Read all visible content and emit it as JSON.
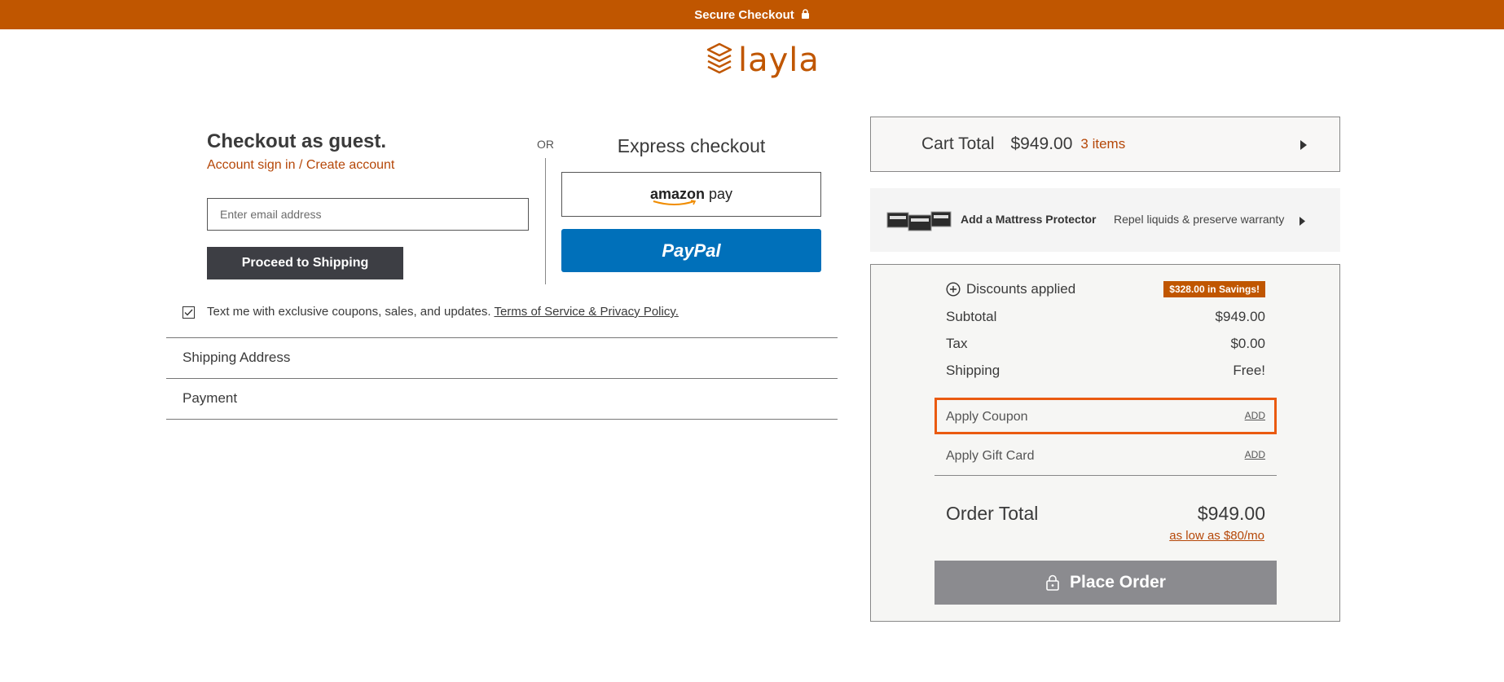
{
  "header": {
    "banner_text": "Secure Checkout",
    "logo_text": "layla",
    "brand_color": "#c05600"
  },
  "guest": {
    "title": "Checkout as guest.",
    "account_link": "Account sign in / Create account",
    "email_placeholder": "Enter email address",
    "proceed_label": "Proceed to Shipping"
  },
  "or_label": "OR",
  "express": {
    "title": "Express checkout",
    "amazon_label_bold": "amazon",
    "amazon_label_pay": "pay",
    "paypal_label": "PayPal"
  },
  "sms": {
    "checked": true,
    "text": "Text me with exclusive coupons, sales, and updates.",
    "tos_link": "Terms of Service & Privacy Policy."
  },
  "sections": {
    "shipping": "Shipping Address",
    "payment": "Payment"
  },
  "cart": {
    "label": "Cart Total",
    "amount": "$949.00",
    "items": "3 items"
  },
  "protector": {
    "title": "Add a Mattress Protector",
    "description": "Repel liquids & preserve warranty"
  },
  "summary": {
    "discounts_label": "Discounts applied",
    "savings_badge": "$328.00 in Savings!",
    "subtotal_label": "Subtotal",
    "subtotal_value": "$949.00",
    "tax_label": "Tax",
    "tax_value": "$0.00",
    "shipping_label": "Shipping",
    "shipping_value": "Free!",
    "coupon_label": "Apply Coupon",
    "coupon_add": "ADD",
    "gift_label": "Apply Gift Card",
    "gift_add": "ADD",
    "order_total_label": "Order Total",
    "order_total_value": "$949.00",
    "monthly": "as low as $80/mo",
    "place_order": "Place Order"
  }
}
